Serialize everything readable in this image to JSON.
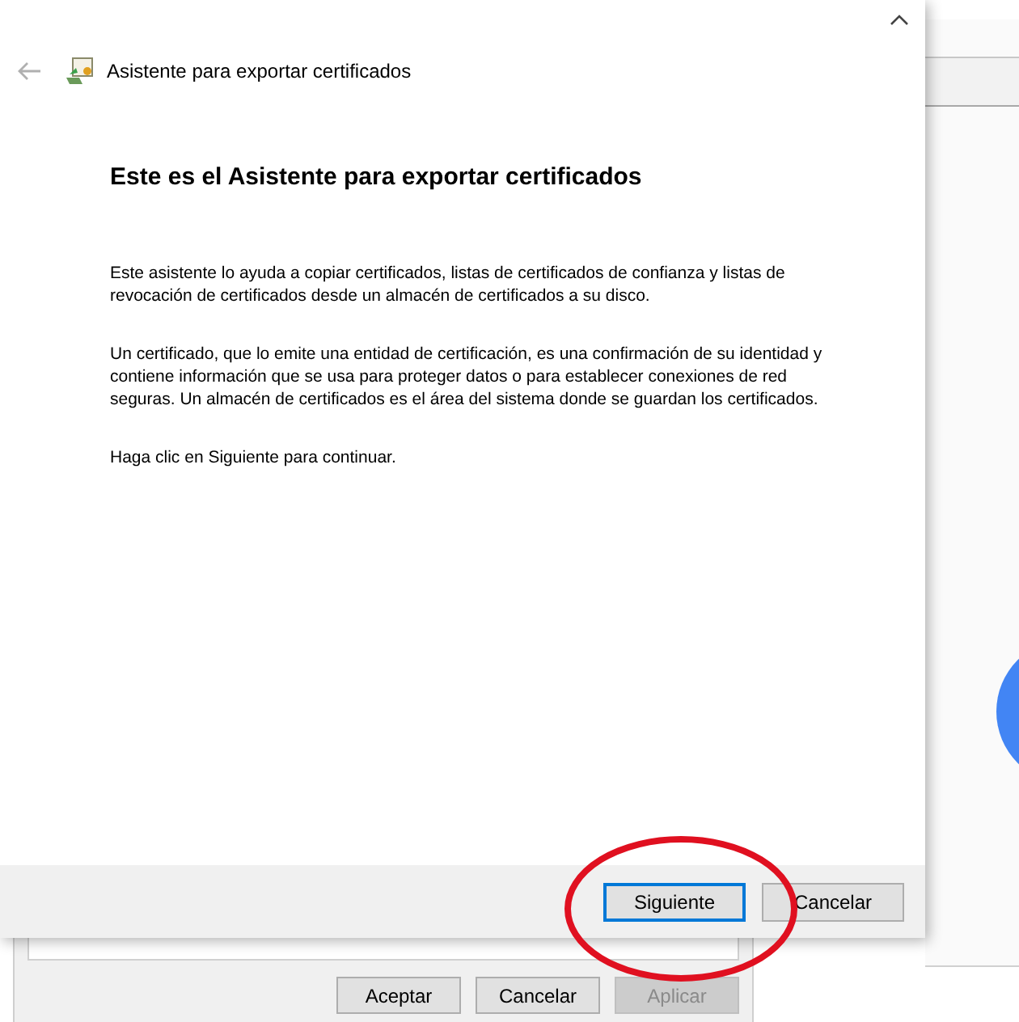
{
  "wizard": {
    "title": "Asistente para exportar certificados",
    "back_disabled": true,
    "heading": "Este es el Asistente para exportar certificados",
    "paragraphs": [
      "Este asistente lo ayuda a copiar certificados, listas de certificados de confianza y listas de revocación de certificados desde un almacén de certificados a su disco.",
      "Un certificado, que lo emite una entidad de certificación, es una confirmación de su identidad y contiene información que se usa para proteger datos o para establecer conexiones de red seguras. Un almacén de certificados es el área del sistema donde se guardan los certificados.",
      "Haga clic en Siguiente para continuar."
    ],
    "buttons": [
      {
        "label": "Siguiente",
        "default": true
      },
      {
        "label": "Cancelar",
        "default": false
      }
    ]
  },
  "background_dialog": {
    "buttons": [
      {
        "label": "Aceptar",
        "disabled": false
      },
      {
        "label": "Cancelar",
        "disabled": false
      },
      {
        "label": "Aplicar",
        "disabled": true
      }
    ]
  }
}
